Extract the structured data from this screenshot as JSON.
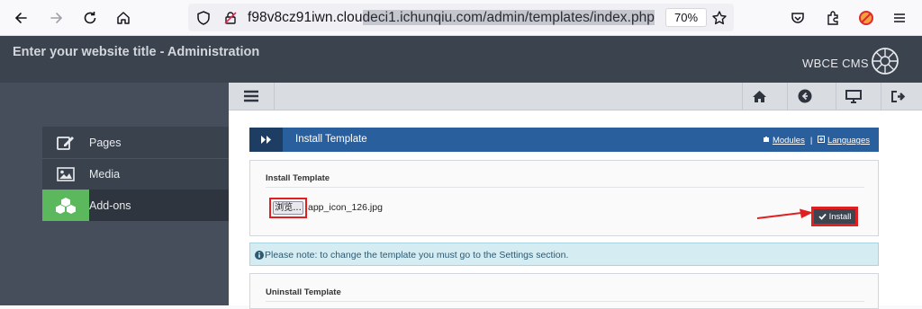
{
  "browser": {
    "url_prefix": "f98v8cz91iwn.clou",
    "url_selected": "deci1.ichunqiu.com/admin/templates/index.php",
    "zoom": "70%"
  },
  "header": {
    "site_title": "Enter your website title - Administration",
    "brand": "WBCE CMS"
  },
  "sidebar": {
    "items": [
      {
        "label": "Pages",
        "icon": "edit-icon"
      },
      {
        "label": "Media",
        "icon": "image-icon"
      },
      {
        "label": "Add-ons",
        "icon": "cubes-icon",
        "active": true
      }
    ]
  },
  "toolbar": {
    "icons": [
      "menu-icon",
      "home-icon",
      "back-icon",
      "monitor-icon",
      "logout-icon"
    ]
  },
  "panel": {
    "title": "Install Template",
    "link_modules": "Modules",
    "separator": "|",
    "link_languages": "Languages"
  },
  "install": {
    "section_title": "Install Template",
    "browse_label": "浏览...",
    "file_name": "app_icon_126.jpg",
    "install_label": "Install"
  },
  "notice": {
    "text": "Please note: to change the template you must go to the Settings section."
  },
  "uninstall": {
    "section_title": "Uninstall Template"
  },
  "colors": {
    "header_bg": "#3b434e",
    "panel_blue": "#2a5f9e",
    "addons_green": "#5cb85c",
    "annotation_red": "#e02020"
  }
}
